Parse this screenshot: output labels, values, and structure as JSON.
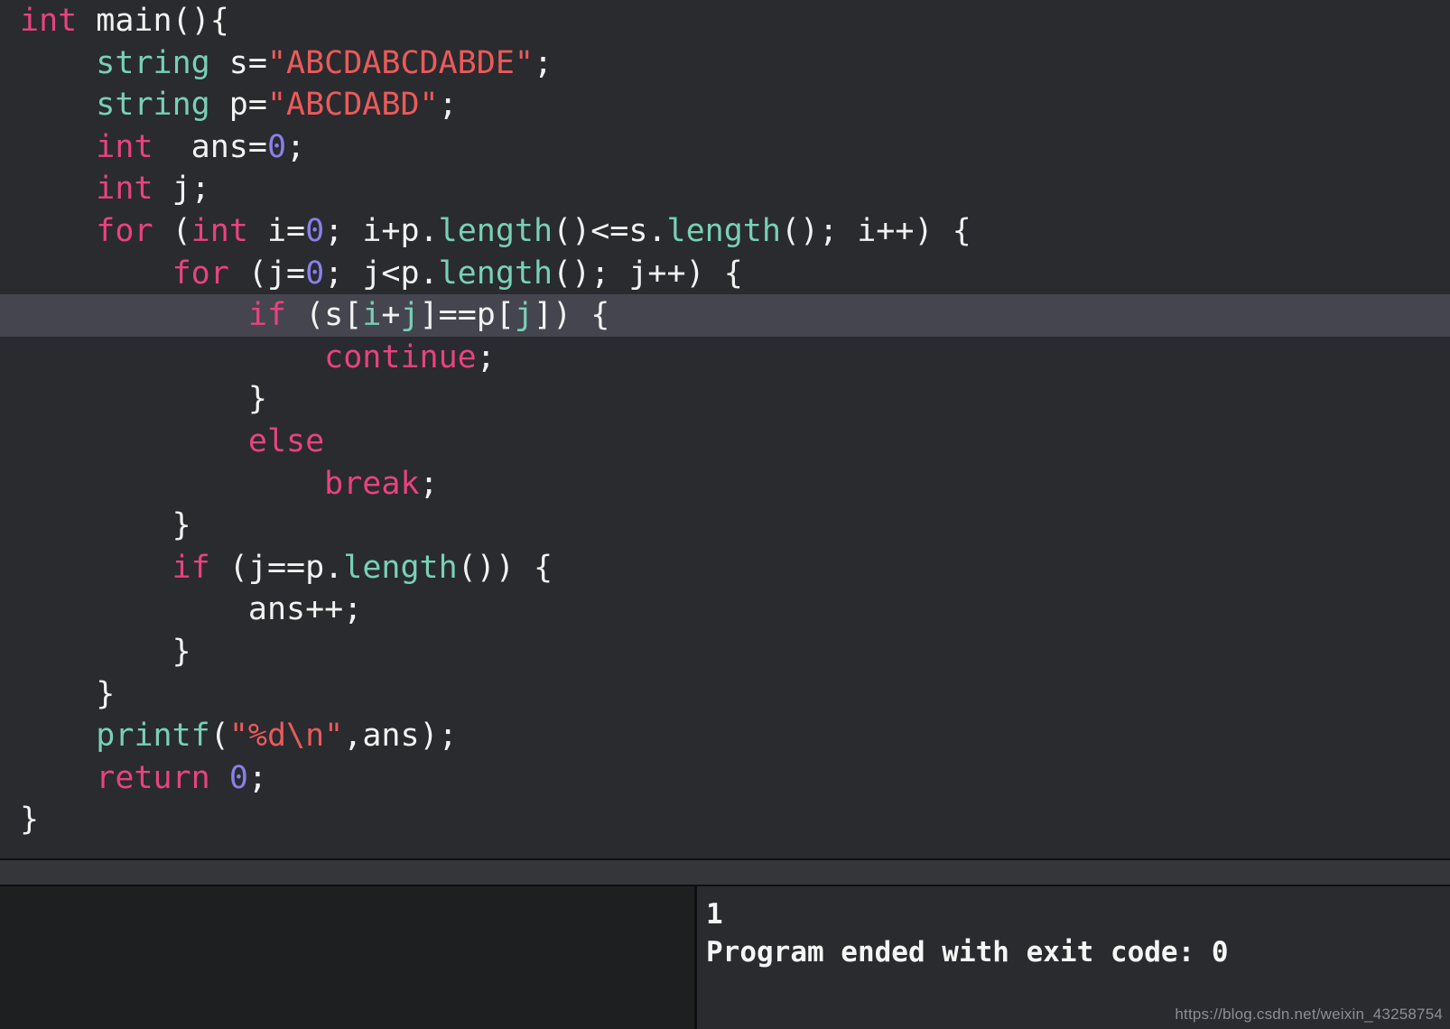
{
  "editor": {
    "language": "cpp",
    "theme": "dark",
    "background_color": "#292b2f",
    "highlighted_line_number": 8,
    "highlight_color": "#45454f",
    "token_colors": {
      "keyword": "#e8437e",
      "function": "#79d0b4",
      "string": "#eb5a5a",
      "number": "#8a80e8",
      "plain": "#f2f2f2",
      "occurrence": "#79d0b4"
    },
    "lines": [
      {
        "indent": "",
        "highlighted": false,
        "tokens": [
          {
            "t": "int",
            "c": "kw"
          },
          {
            "t": " main(){",
            "c": "plain"
          }
        ]
      },
      {
        "indent": "    ",
        "highlighted": false,
        "tokens": [
          {
            "t": "string",
            "c": "fn"
          },
          {
            "t": " s=",
            "c": "plain"
          },
          {
            "t": "\"ABCDABCDABDE\"",
            "c": "str"
          },
          {
            "t": ";",
            "c": "plain"
          }
        ]
      },
      {
        "indent": "    ",
        "highlighted": false,
        "tokens": [
          {
            "t": "string",
            "c": "fn"
          },
          {
            "t": " p=",
            "c": "plain"
          },
          {
            "t": "\"ABCDABD\"",
            "c": "str"
          },
          {
            "t": ";",
            "c": "plain"
          }
        ]
      },
      {
        "indent": "    ",
        "highlighted": false,
        "tokens": [
          {
            "t": "int",
            "c": "kw"
          },
          {
            "t": "  ans=",
            "c": "plain"
          },
          {
            "t": "0",
            "c": "num"
          },
          {
            "t": ";",
            "c": "plain"
          }
        ]
      },
      {
        "indent": "    ",
        "highlighted": false,
        "tokens": [
          {
            "t": "int",
            "c": "kw"
          },
          {
            "t": " j;",
            "c": "plain"
          }
        ]
      },
      {
        "indent": "    ",
        "highlighted": false,
        "tokens": [
          {
            "t": "for",
            "c": "kw"
          },
          {
            "t": " (",
            "c": "plain"
          },
          {
            "t": "int",
            "c": "kw"
          },
          {
            "t": " i=",
            "c": "plain"
          },
          {
            "t": "0",
            "c": "num"
          },
          {
            "t": "; i+p.",
            "c": "plain"
          },
          {
            "t": "length",
            "c": "fn"
          },
          {
            "t": "()<=s.",
            "c": "plain"
          },
          {
            "t": "length",
            "c": "fn"
          },
          {
            "t": "(); i++) {",
            "c": "plain"
          }
        ]
      },
      {
        "indent": "        ",
        "highlighted": false,
        "tokens": [
          {
            "t": "for",
            "c": "kw"
          },
          {
            "t": " (j=",
            "c": "plain"
          },
          {
            "t": "0",
            "c": "num"
          },
          {
            "t": "; j<p.",
            "c": "plain"
          },
          {
            "t": "length",
            "c": "fn"
          },
          {
            "t": "(); j++) {",
            "c": "plain"
          }
        ]
      },
      {
        "indent": "            ",
        "highlighted": true,
        "tokens": [
          {
            "t": "if",
            "c": "kw"
          },
          {
            "t": " (s[",
            "c": "plain"
          },
          {
            "t": "i",
            "c": "occ"
          },
          {
            "t": "+",
            "c": "plain"
          },
          {
            "t": "j",
            "c": "occ"
          },
          {
            "t": "]==p[",
            "c": "plain"
          },
          {
            "t": "j",
            "c": "occ"
          },
          {
            "t": "]) {",
            "c": "plain"
          }
        ]
      },
      {
        "indent": "                ",
        "highlighted": false,
        "tokens": [
          {
            "t": "continue",
            "c": "kw"
          },
          {
            "t": ";",
            "c": "plain"
          }
        ]
      },
      {
        "indent": "            ",
        "highlighted": false,
        "tokens": [
          {
            "t": "}",
            "c": "plain"
          }
        ]
      },
      {
        "indent": "            ",
        "highlighted": false,
        "tokens": [
          {
            "t": "else",
            "c": "kw"
          }
        ]
      },
      {
        "indent": "                ",
        "highlighted": false,
        "tokens": [
          {
            "t": "break",
            "c": "kw"
          },
          {
            "t": ";",
            "c": "plain"
          }
        ]
      },
      {
        "indent": "        ",
        "highlighted": false,
        "tokens": [
          {
            "t": "}",
            "c": "plain"
          }
        ]
      },
      {
        "indent": "        ",
        "highlighted": false,
        "tokens": [
          {
            "t": "if",
            "c": "kw"
          },
          {
            "t": " (j==p.",
            "c": "plain"
          },
          {
            "t": "length",
            "c": "fn"
          },
          {
            "t": "()) {",
            "c": "plain"
          }
        ]
      },
      {
        "indent": "            ",
        "highlighted": false,
        "tokens": [
          {
            "t": "ans++;",
            "c": "plain"
          }
        ]
      },
      {
        "indent": "        ",
        "highlighted": false,
        "tokens": [
          {
            "t": "}",
            "c": "plain"
          }
        ]
      },
      {
        "indent": "    ",
        "highlighted": false,
        "tokens": [
          {
            "t": "}",
            "c": "plain"
          }
        ]
      },
      {
        "indent": "    ",
        "highlighted": false,
        "tokens": [
          {
            "t": "printf",
            "c": "fn"
          },
          {
            "t": "(",
            "c": "plain"
          },
          {
            "t": "\"%d\\n\"",
            "c": "str"
          },
          {
            "t": ",ans);",
            "c": "plain"
          }
        ]
      },
      {
        "indent": "    ",
        "highlighted": false,
        "tokens": [
          {
            "t": "return",
            "c": "kw"
          },
          {
            "t": " ",
            "c": "plain"
          },
          {
            "t": "0",
            "c": "num"
          },
          {
            "t": ";",
            "c": "plain"
          }
        ]
      },
      {
        "indent": "",
        "highlighted": false,
        "tokens": [
          {
            "t": "}",
            "c": "plain"
          }
        ]
      }
    ]
  },
  "console": {
    "left_panel_background": "#1d1f21",
    "left_panel_lines": [],
    "output_lines": [
      "1",
      "Program ended with exit code: 0"
    ]
  },
  "watermark": {
    "text": "https://blog.csdn.net/weixin_43258754"
  }
}
